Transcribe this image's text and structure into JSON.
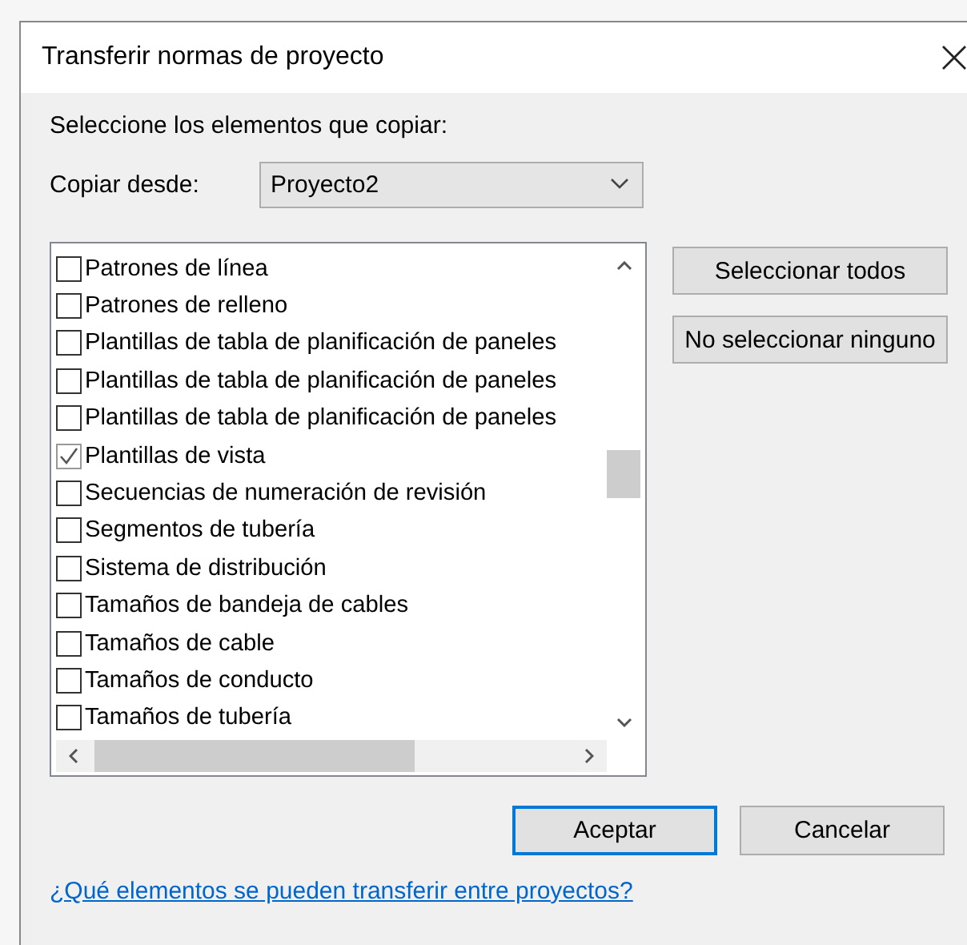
{
  "window": {
    "title": "Transferir normas de proyecto"
  },
  "instruction": "Seleccione los elementos que copiar:",
  "copy_from": {
    "label": "Copiar desde:",
    "value": "Proyecto2"
  },
  "items": [
    {
      "label": "Patrones de línea",
      "checked": false
    },
    {
      "label": "Patrones de relleno",
      "checked": false
    },
    {
      "label": "Plantillas de tabla de planificación de paneles",
      "checked": false
    },
    {
      "label": "Plantillas de tabla de planificación de paneles",
      "checked": false
    },
    {
      "label": "Plantillas de tabla de planificación de paneles",
      "checked": false
    },
    {
      "label": "Plantillas de vista",
      "checked": true
    },
    {
      "label": "Secuencias de numeración de revisión",
      "checked": false
    },
    {
      "label": "Segmentos de tubería",
      "checked": false
    },
    {
      "label": "Sistema de distribución",
      "checked": false
    },
    {
      "label": "Tamaños de bandeja de cables",
      "checked": false
    },
    {
      "label": "Tamaños de cable",
      "checked": false
    },
    {
      "label": "Tamaños de conducto",
      "checked": false
    },
    {
      "label": "Tamaños de tubería",
      "checked": false
    }
  ],
  "side_buttons": [
    "Seleccionar todos",
    "No seleccionar ninguno"
  ],
  "footer_buttons": [
    {
      "label": "Aceptar",
      "default": true
    },
    {
      "label": "Cancelar",
      "default": false
    }
  ],
  "help_link": "¿Qué elementos se pueden transferir entre proyectos?"
}
